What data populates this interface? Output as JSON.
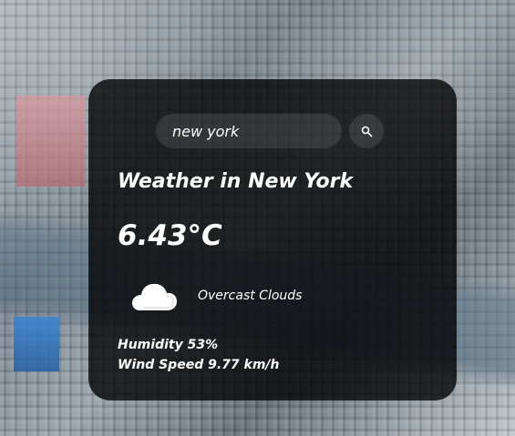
{
  "search": {
    "value": "new york",
    "placeholder": "",
    "button_icon": "search-icon"
  },
  "weather": {
    "title": "Weather in New York",
    "temperature": "6.43°C",
    "condition": "Overcast Clouds",
    "condition_icon": "cloud-icon",
    "humidity": "Humidity 53%",
    "wind_speed": "Wind Speed 9.77 km/h"
  },
  "colors": {
    "card_background": "#000000",
    "text": "#ffffff"
  }
}
